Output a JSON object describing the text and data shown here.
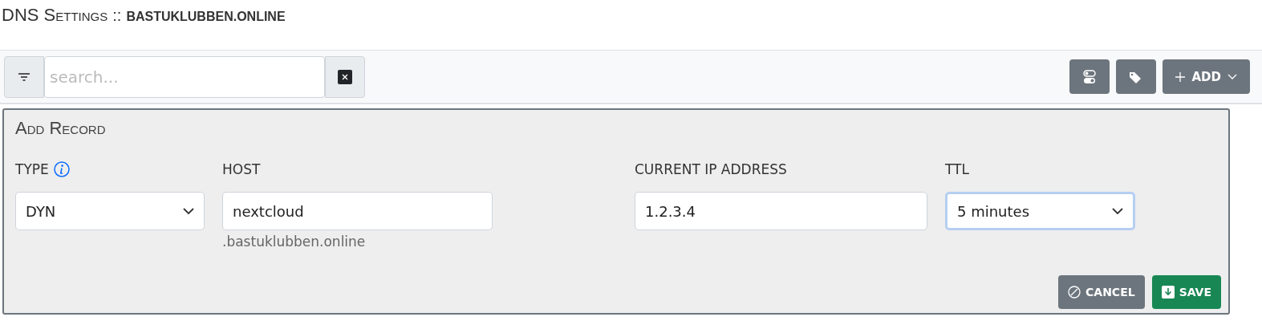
{
  "page": {
    "title": "DNS Settings",
    "separator": "::",
    "domain": "BASTUKLUBBEN.ONLINE"
  },
  "toolbar": {
    "search": {
      "placeholder": "search..."
    },
    "add_label": "ADD"
  },
  "add_record": {
    "title": "Add Record",
    "fields": [
      {
        "label": "TYPE",
        "kind": "select",
        "value": "DYN",
        "info": true,
        "focused": false
      },
      {
        "label": "HOST",
        "kind": "input",
        "value": "nextcloud",
        "hint": ".bastuklubben.online",
        "info": false,
        "focused": false
      },
      {
        "label": "CURRENT IP ADDRESS",
        "kind": "input",
        "value": "1.2.3.4",
        "info": false,
        "focused": false
      },
      {
        "label": "TTL",
        "kind": "select",
        "value": "5 minutes",
        "info": false,
        "focused": true
      }
    ],
    "buttons": [
      {
        "label": "CANCEL",
        "kind": "cancel"
      },
      {
        "label": "SAVE",
        "kind": "save"
      }
    ]
  }
}
